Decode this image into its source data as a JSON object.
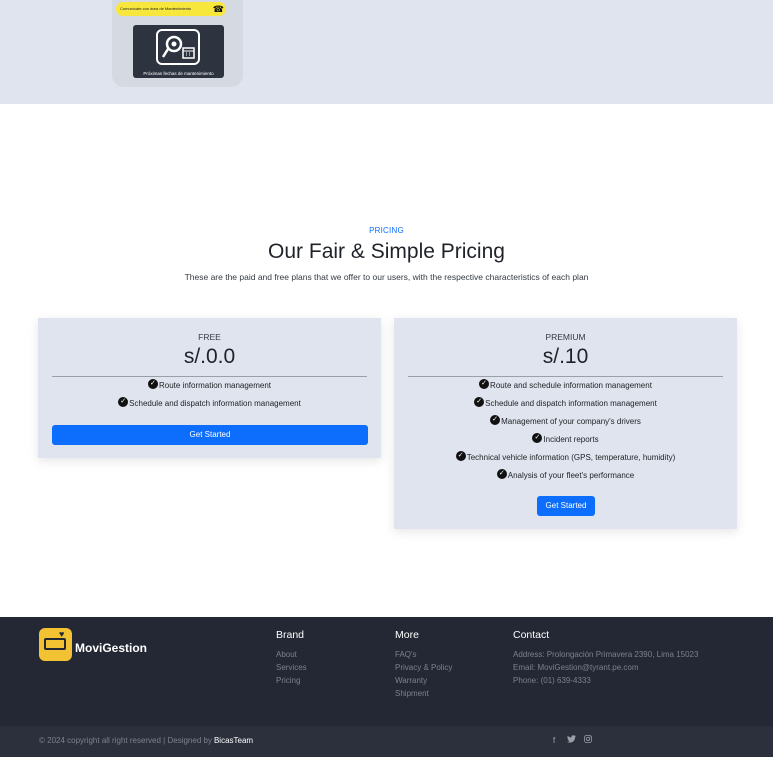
{
  "hero": {
    "banner_text": "Comunícate con área de Mantenimiento",
    "phone_icon": "phone-icon",
    "tile_icon": "steam-wrench-calendar-icon",
    "tile_caption": "Próximas fechas de mantenimiento"
  },
  "pricing": {
    "label": "PRICING",
    "title": "Our Fair & Simple Pricing",
    "subtitle": "These are the paid and free plans that we offer to our users, with the respective characteristics of each plan",
    "plans": [
      {
        "name": "FREE",
        "price": "s/.0.0",
        "features": [
          "Route information management",
          "Schedule and dispatch information management"
        ],
        "button": "Get Started"
      },
      {
        "name": "PREMIUM",
        "price": "s/.10",
        "features": [
          "Route and schedule information management",
          "Schedule and dispatch information management",
          "Management of your company's drivers",
          "Incident reports",
          "Technical vehicle information (GPS, temperature, humidity)",
          "Analysis of your fleet's performance"
        ],
        "button": "Get Started"
      }
    ]
  },
  "footer": {
    "brand_name": "MoviGestion",
    "columns": {
      "brand": {
        "title": "Brand",
        "links": [
          "About",
          "Services",
          "Pricing"
        ]
      },
      "more": {
        "title": "More",
        "links": [
          "FAQ's",
          "Privacy & Policy",
          "Warranty",
          "Shipment"
        ]
      },
      "contact": {
        "title": "Contact",
        "lines": [
          "Address: Prolongación Primavera 2390, Lima 15023",
          "Email: MoviGestion@tyrant.pe.com",
          "Phone: (01) 639-4333"
        ]
      }
    },
    "copyright": "© 2024 copyright all right reserved | Designed by",
    "designer": "BicasTeam",
    "socials": [
      "facebook-icon",
      "twitter-icon",
      "instagram-icon"
    ]
  },
  "colors": {
    "accent": "#0d6efd",
    "card_bg": "#dfe4ee",
    "footer_bg": "#232834",
    "logo_yellow": "#f2c233"
  }
}
